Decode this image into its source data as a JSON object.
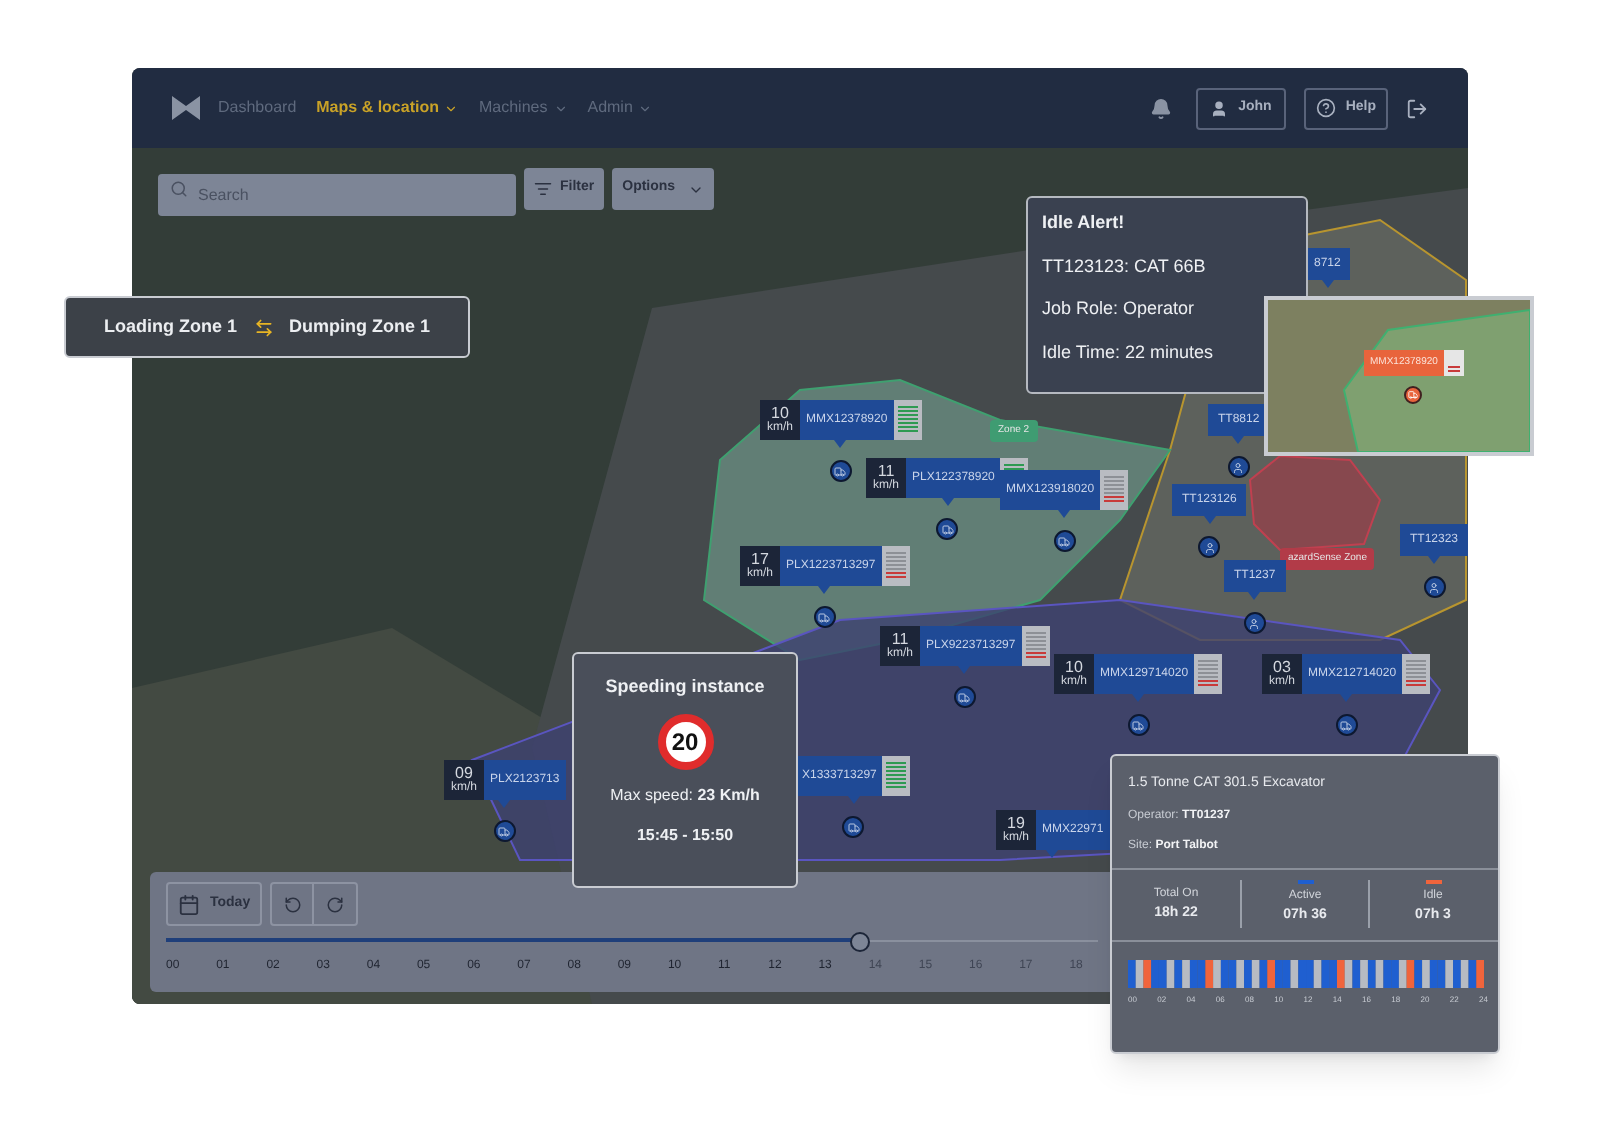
{
  "nav": {
    "items": [
      {
        "label": "Dashboard",
        "selected": false,
        "dropdown": false
      },
      {
        "label": "Maps & location",
        "selected": true,
        "dropdown": true
      },
      {
        "label": "Machines",
        "selected": false,
        "dropdown": true
      },
      {
        "label": "Admin",
        "selected": false,
        "dropdown": true
      }
    ],
    "user": "John",
    "help": "Help"
  },
  "toolbar": {
    "search": {
      "placeholder": "Search"
    },
    "filter": "Filter",
    "options": "Options"
  },
  "route": {
    "from": "Loading Zone 1",
    "to": "Dumping Zone 1"
  },
  "zones": [
    {
      "label": "Zone 2",
      "color": "#3f9c72"
    },
    {
      "label": "azardSense Zone",
      "color": "#b23b48"
    }
  ],
  "machines": [
    {
      "speed": "10",
      "unit": "km/h",
      "id": "MMX12378920",
      "level": 1
    },
    {
      "speed": "11",
      "unit": "km/h",
      "id": "PLX122378920",
      "level": 1
    },
    {
      "id": "MMX123918020",
      "level": 0.3
    },
    {
      "speed": "17",
      "unit": "km/h",
      "id": "PLX1223713297",
      "level": 0.3
    },
    {
      "speed": "11",
      "unit": "km/h",
      "id": "PLX9223713297",
      "level": 0.3
    },
    {
      "speed": "10",
      "unit": "km/h",
      "id": "MMX129714020",
      "level": 0.3
    },
    {
      "speed": "03",
      "unit": "km/h",
      "id": "MMX212714020",
      "level": 0.3
    },
    {
      "speed": "09",
      "unit": "km/h",
      "id": "PLX2123713"
    },
    {
      "id": "X1333713297",
      "level": 1
    },
    {
      "speed": "19",
      "unit": "km/h",
      "id": "MMX22971"
    }
  ],
  "operators": [
    {
      "id": "8712"
    },
    {
      "id": "TT8812"
    },
    {
      "id": "TT123126"
    },
    {
      "id": "TT1237"
    },
    {
      "id": "TT12323"
    }
  ],
  "idle_alert": {
    "title": "Idle Alert!",
    "lines": [
      "TT123123: CAT 66B",
      "Job Role: Operator",
      "Idle Time: 22 minutes"
    ]
  },
  "inset_map": {
    "machine": "MMX12378920"
  },
  "speeding": {
    "title": "Speeding instance",
    "limit": "20",
    "max_speed": "Max speed: **23 Km/h**",
    "time": "15:45 - 15:50"
  },
  "timeline": {
    "today": "Today",
    "level": 0.745,
    "hours": [
      "00",
      "01",
      "02",
      "03",
      "04",
      "05",
      "06",
      "07",
      "08",
      "09",
      "10",
      "11",
      "12",
      "13",
      "14",
      "15",
      "16",
      "17",
      "18"
    ]
  },
  "machine_card": {
    "title": "1.5 Tonne CAT 301.5 Excavator",
    "operator_label": "Operator:",
    "operator": "TT01237",
    "site_label": "Site:",
    "site": "Port Talbot",
    "stats": [
      {
        "label": "Total On",
        "value": "18h 22"
      },
      {
        "label": "Active",
        "value": "07h 36",
        "color": "#1f5fd0"
      },
      {
        "label": "Idle",
        "value": "07h 3",
        "color": "#f0643c"
      }
    ],
    "hours": [
      "00",
      "02",
      "04",
      "06",
      "08",
      "10",
      "12",
      "14",
      "16",
      "18",
      "20",
      "22",
      "24"
    ]
  }
}
